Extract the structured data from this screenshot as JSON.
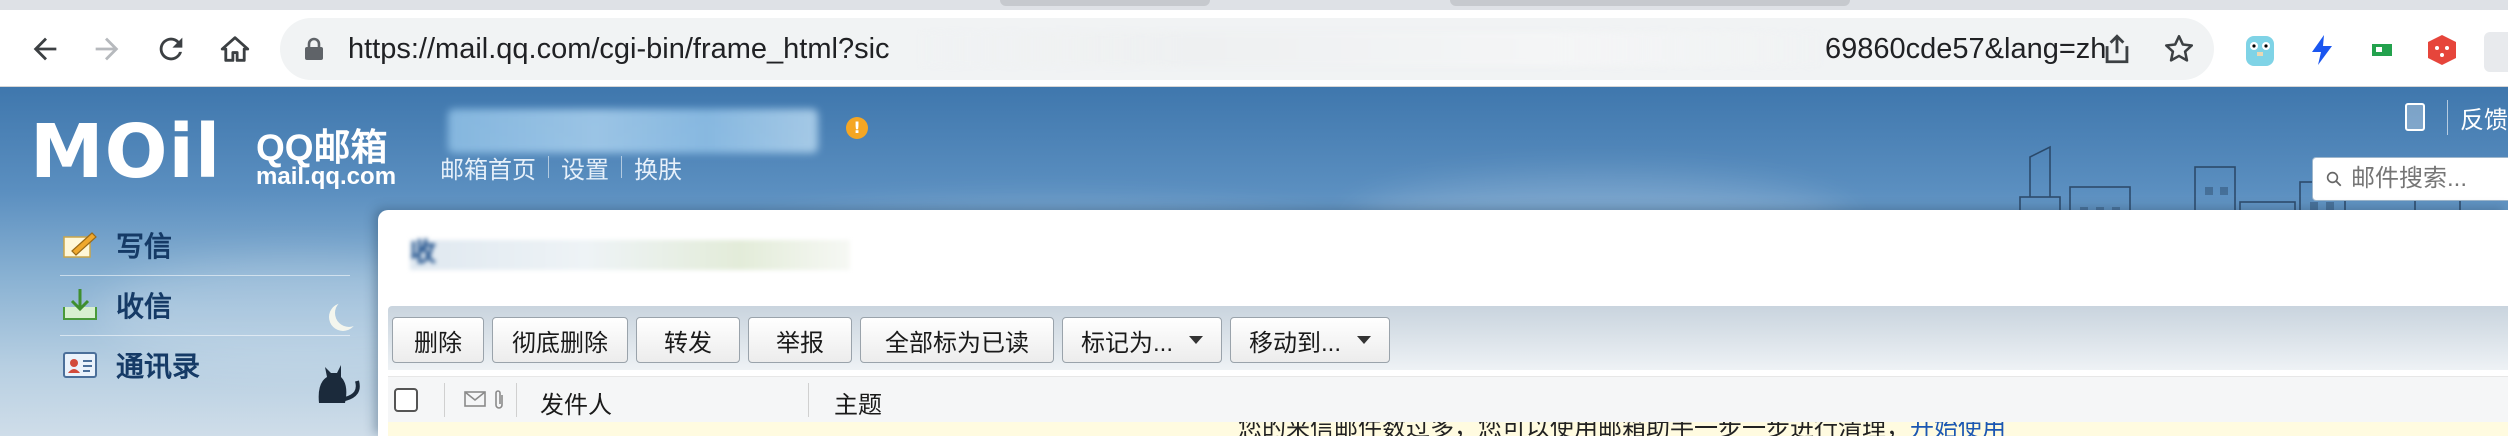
{
  "browser": {
    "url_visible_start": "https://mail.qq.com/cgi-bin/frame_html?sic",
    "url_visible_end": "69860cde57&lang=zh",
    "icons": [
      "back-icon",
      "forward-icon",
      "reload-icon",
      "home-icon",
      "lock-icon",
      "share-icon",
      "bookmark-star-icon"
    ],
    "extensions": [
      "gopher-extension-icon",
      "lightning-extension-icon",
      "flag-extension-icon",
      "dice-extension-icon"
    ]
  },
  "mail": {
    "brand": {
      "logo_text": "MOil",
      "name_cn": "QQ邮箱",
      "name_en": "mail.qq.com"
    },
    "top_links": [
      "邮箱首页",
      "设置",
      "换肤"
    ],
    "alert_badge": "!",
    "feedback": "反馈",
    "search": {
      "placeholder": "邮件搜索..."
    },
    "left_nav": [
      {
        "label": "写信",
        "icon": "compose-icon"
      },
      {
        "label": "收信",
        "icon": "inbox-download-icon"
      },
      {
        "label": "通讯录",
        "icon": "contacts-card-icon"
      }
    ],
    "folder_title_fragment": "收",
    "toolbar": {
      "delete": "删除",
      "permanent_delete": "彻底删除",
      "forward": "转发",
      "report": "举报",
      "mark_all_read": "全部标为已读",
      "mark_as": "标记为...",
      "move_to": "移动到..."
    },
    "list_header": {
      "sender": "发件人",
      "subject": "主题"
    },
    "notice": {
      "text": "您的来信邮件数过多，您可以使用邮箱助手一步一步进行清理，",
      "link": "开始使用"
    },
    "colors": {
      "header_sky_top": "#3f77ad",
      "nav_label": "#153a66",
      "alert": "#f5a623",
      "notice_bg": "#fffbe0",
      "link": "#1b57b3"
    }
  }
}
